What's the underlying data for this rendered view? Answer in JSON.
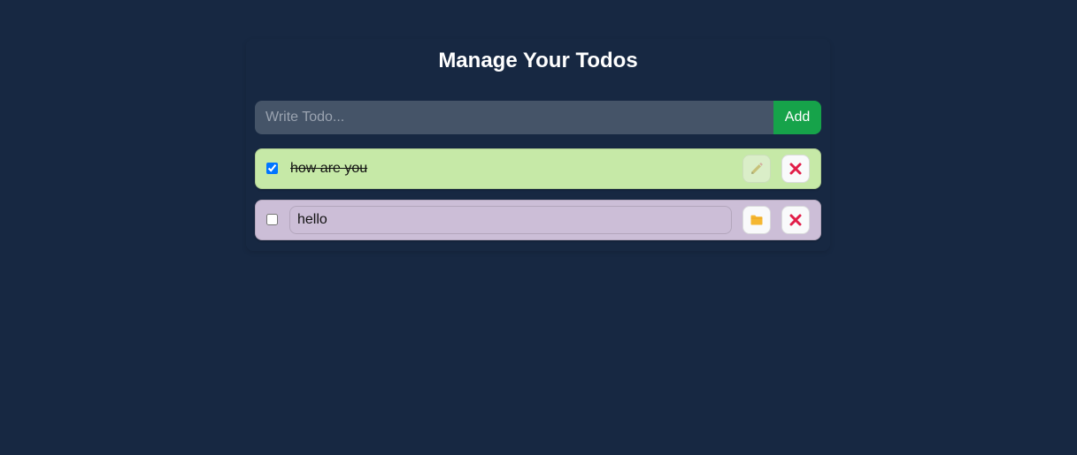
{
  "header": {
    "title": "Manage Your Todos"
  },
  "form": {
    "placeholder": "Write Todo...",
    "value": "",
    "add_label": "Add"
  },
  "todos": [
    {
      "text": "how are you",
      "completed": true,
      "editing": false,
      "background": "#c6e9a7",
      "edit_icon": "pencil-icon",
      "delete_icon": "close-icon"
    },
    {
      "text": "hello",
      "completed": false,
      "editing": true,
      "background": "#ccbed7",
      "edit_icon": "folder-icon",
      "delete_icon": "close-icon"
    }
  ],
  "colors": {
    "page_background": "#172842",
    "input_background": "#455468",
    "add_button": "#16a34a",
    "delete_icon": "#e11d48",
    "folder_icon": "#f5b731"
  }
}
